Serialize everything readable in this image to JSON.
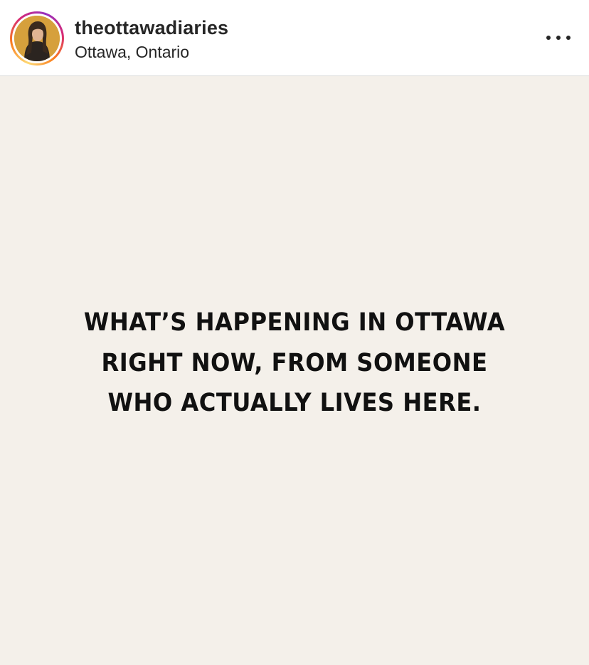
{
  "post": {
    "header": {
      "username": "theottawadiaries",
      "location": "Ottawa, Ontario",
      "avatar_icon": "profile-photo",
      "more_icon": "more-horizontal-icon"
    },
    "image": {
      "background_color": "#f4f0ea",
      "text_color": "#111111",
      "headline_lines": [
        "WHAT’S HAPPENING IN OTTAWA",
        "RIGHT NOW, FROM SOMEONE",
        "WHO ACTUALLY LIVES HERE."
      ]
    }
  }
}
